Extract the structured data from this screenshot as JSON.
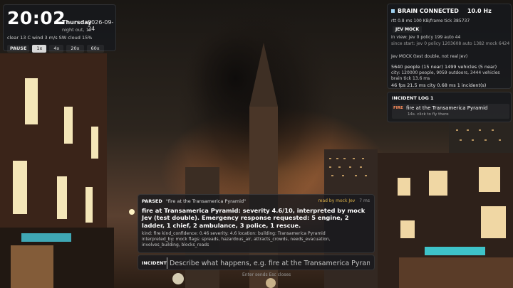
{
  "clock": {
    "time": "20:02",
    "day": "Thursday",
    "date": "2026-09-24",
    "status": "night out, 1x",
    "weather": "clear  13 C  wind 3 m/s SW  cloud 15%",
    "pause_label": "PAUSE",
    "speeds": [
      "1x",
      "4x",
      "20x",
      "60x"
    ],
    "active_speed": "1x"
  },
  "brain": {
    "status": "BRAIN  CONNECTED",
    "rate": "10.0 Hz",
    "stats": "rtt 0.8 ms   100 KB/frame   tick 385737",
    "section": "JEV MOCK",
    "in_view": "in view:  jev 0    policy 199    auto 44",
    "since_start": "since start: jev 0    policy 1203608    auto 1382    mock 6424",
    "note": "Jev MOCK (test double, not real Jev)",
    "people": "5640 people (15 near)     1499 vehicles (5 near)",
    "city": "city: 120000 people, 9059 outdoors, 3444 vehicles",
    "brain_tick": "brain tick 13.6 ms",
    "perf": "46 fps    21.5 ms    city 0.68 ms    1 incident(s)"
  },
  "incident_log": {
    "title": "INCIDENT LOG  1",
    "items": [
      {
        "tag": "FIRE",
        "text": "fire at the Transamerica Pyramid",
        "hint": "14s. click to fly there"
      }
    ]
  },
  "parsed": {
    "label": "PARSED",
    "query": "\"fire at the Transamerica Pyramid\"",
    "read_by": "read by mock Jev",
    "latency": "7 ms",
    "summary": "fire at Transamerica Pyramid: severity 4.6/10, interpreted by mock Jev (test double). Emergency response requested: 5 engine, 2 ladder, 1 chief, 2 ambulance, 3 police, 1 rescue.",
    "line1": "kind: fire     kind_confidence: 0.46     severity: 4.6     location: building: Transamerica Pyramid",
    "line2": "interpreted_by: mock     flags: spreads, hazardous_air, attracts_crowds, needs_evacuation,",
    "line3": "involves_building, blocks_roads"
  },
  "incident_input": {
    "label": "INCIDENT",
    "placeholder": "Describe what happens, e.g. fire at the Transamerica Pyramid",
    "hint": "Enter sends     Esc closes"
  },
  "colors": {
    "fire_tag": "#ff8f5c",
    "read_by": "#e2b64a",
    "connected_dot": "#9fd0ef"
  }
}
